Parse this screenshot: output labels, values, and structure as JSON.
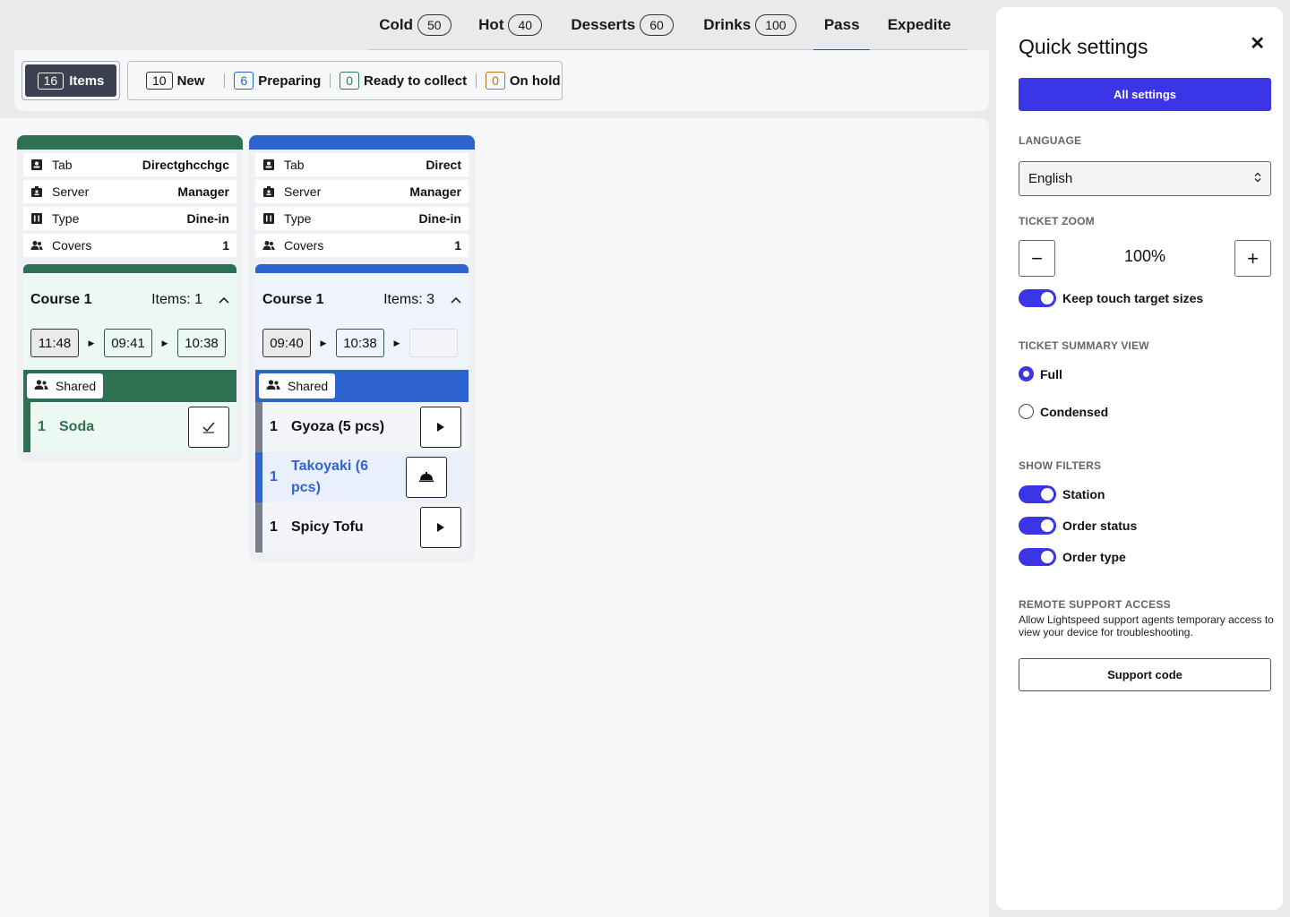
{
  "station_tabs": [
    {
      "label": "Cold",
      "count": "50"
    },
    {
      "label": "Hot",
      "count": "40"
    },
    {
      "label": "Desserts",
      "count": "60"
    },
    {
      "label": "Drinks",
      "count": "100"
    },
    {
      "label": "Pass"
    },
    {
      "label": "Expedite"
    }
  ],
  "filters": {
    "items": {
      "count": "16",
      "label": "Items"
    },
    "new": {
      "count": "10",
      "label": "New"
    },
    "preparing": {
      "count": "6",
      "label": "Preparing"
    },
    "ready": {
      "count": "0",
      "label": "Ready to collect"
    },
    "on_hold": {
      "count": "0",
      "label": "On hold"
    }
  },
  "tickets": [
    {
      "color": "#2e7152",
      "tab_label": "Tab",
      "tab_value": "Directghcchgc",
      "server_label": "Server",
      "server_value": "Manager",
      "type_label": "Type",
      "type_value": "Dine-in",
      "covers_label": "Covers",
      "covers_value": "1",
      "course_title": "Course 1",
      "course_items": "Items: 1",
      "times": [
        "11:48",
        "09:41",
        "10:38"
      ],
      "shared_label": "Shared",
      "items": [
        {
          "qty": "1",
          "name": "Soda",
          "action": "check-icon"
        }
      ]
    },
    {
      "color": "#2f64d0",
      "tab_label": "Tab",
      "tab_value": "Direct",
      "server_label": "Server",
      "server_value": "Manager",
      "type_label": "Type",
      "type_value": "Dine-in",
      "covers_label": "Covers",
      "covers_value": "1",
      "course_title": "Course 1",
      "course_items": "Items: 3",
      "times": [
        "09:40",
        "10:38",
        ""
      ],
      "shared_label": "Shared",
      "items": [
        {
          "qty": "1",
          "name": "Gyoza (5 pcs)",
          "action": "play-icon"
        },
        {
          "qty": "1",
          "name": "Takoyaki (6 pcs)",
          "action": "cloche-icon"
        },
        {
          "qty": "1",
          "name": "Spicy Tofu",
          "action": "play-icon"
        }
      ]
    }
  ],
  "quick_settings": {
    "title": "Quick settings",
    "close_icon": "close-icon",
    "all_settings": "All settings",
    "language_label": "LANGUAGE",
    "language_value": "English",
    "zoom_label": "TICKET ZOOM",
    "zoom_value": "100%",
    "keep_touch": "Keep touch target sizes",
    "summary_label": "TICKET SUMMARY VIEW",
    "summary_full": "Full",
    "summary_condensed": "Condensed",
    "filters_label": "SHOW FILTERS",
    "filter_station": "Station",
    "filter_order_status": "Order status",
    "filter_order_type": "Order type",
    "remote_label": "REMOTE SUPPORT ACCESS",
    "remote_text": "Allow Lightspeed support agents temporary access to view your device for troubleshooting.",
    "support_code": "Support code"
  },
  "colors": {
    "accent": "#3b35e8",
    "green": "#2e7152",
    "blue": "#2f64d0"
  }
}
